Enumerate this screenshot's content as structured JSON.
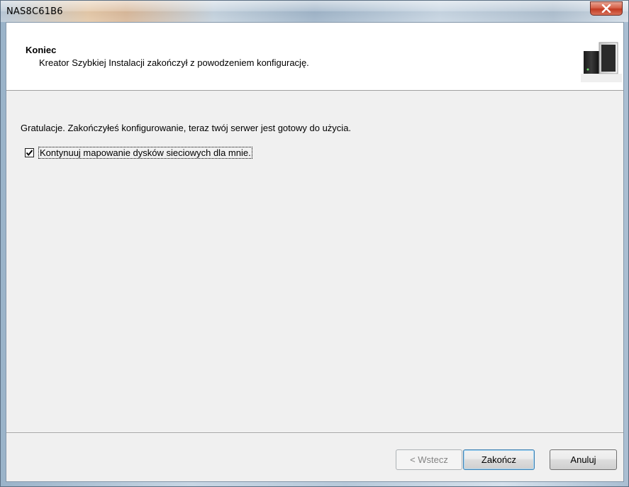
{
  "window": {
    "title": "NAS8C61B6"
  },
  "header": {
    "title": "Koniec",
    "subtitle": "Kreator Szybkiej Instalacji zakończył z powodzeniem konfigurację."
  },
  "content": {
    "message": "Gratulacje. Zakończyłeś konfigurowanie, teraz twój serwer jest gotowy do użycia.",
    "checkbox": {
      "label": "Kontynuuj mapowanie dysków sieciowych dla mnie.",
      "checked": true
    }
  },
  "buttons": {
    "back_label": "< Wstecz",
    "finish_label": "Zakończ",
    "cancel_label": "Anuluj"
  },
  "icons": {
    "close": "close-icon",
    "check": "checkmark-icon",
    "product": "nas-device-icon"
  },
  "colors": {
    "close_button": "#c23b22",
    "default_button_border": "#3c7fb1",
    "dialog_background": "#f0f0f0"
  }
}
